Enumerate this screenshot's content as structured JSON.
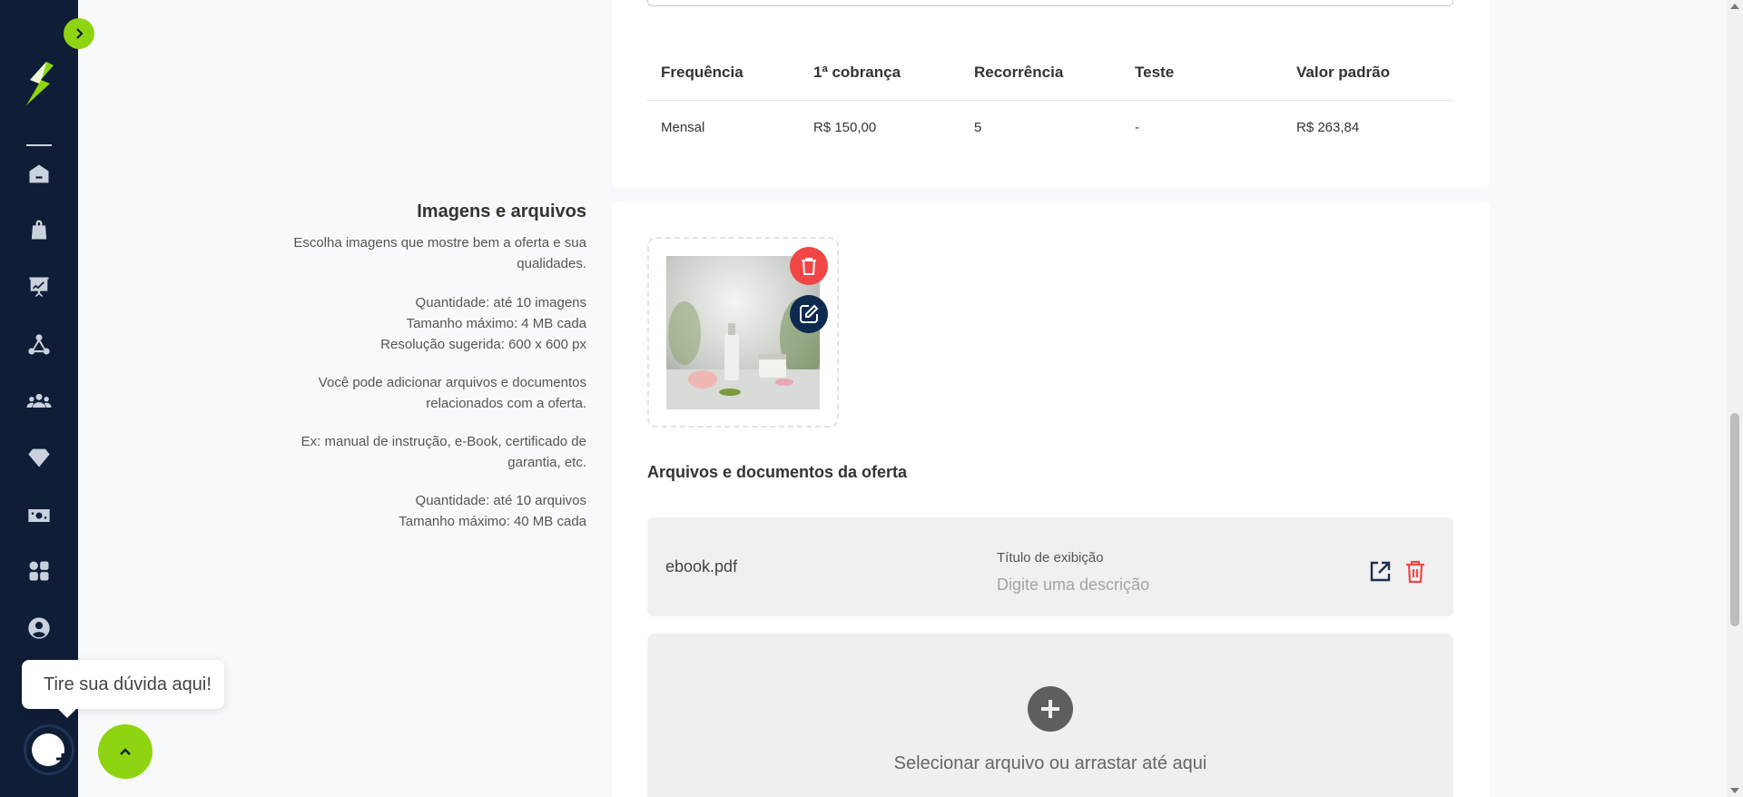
{
  "sidebar": {
    "items": [
      {
        "icon": "home-icon"
      },
      {
        "icon": "shopping-bag-icon"
      },
      {
        "icon": "presentation-chart-icon"
      },
      {
        "icon": "network-icon"
      },
      {
        "icon": "users-group-icon"
      },
      {
        "icon": "diamond-icon"
      },
      {
        "icon": "cash-icon"
      },
      {
        "icon": "apps-grid-icon"
      },
      {
        "icon": "user-circle-icon"
      }
    ]
  },
  "pricing_table": {
    "headers": [
      "Frequência",
      "1ª cobrança",
      "Recorrência",
      "Teste",
      "Valor padrão"
    ],
    "rows": [
      [
        "Mensal",
        "R$ 150,00",
        "5",
        "-",
        "R$ 263,84"
      ]
    ]
  },
  "images_section": {
    "title": "Imagens e arquivos",
    "desc1": "Escolha imagens que mostre bem a oferta e sua qualidades.",
    "desc2_line1": "Quantidade: até 10 imagens",
    "desc2_line2": "Tamanho máximo: 4 MB cada",
    "desc2_line3": "Resolução sugerida: 600 x 600 px",
    "desc3": "Você pode adicionar arquivos e documentos relacionados com a oferta.",
    "desc4": "Ex: manual de instrução, e-Book, certificado de garantia, etc.",
    "desc5_line1": "Quantidade: até 10 arquivos",
    "desc5_line2": "Tamanho máximo: 40 MB cada"
  },
  "files_section": {
    "title": "Arquivos e documentos da oferta",
    "file_name": "ebook.pdf",
    "display_title_label": "Título de exibição",
    "display_title_placeholder": "Digite uma descrição",
    "dropzone_text": "Selecionar arquivo ou arrastar até aqui"
  },
  "help": {
    "tooltip": "Tire sua dúvida aqui!"
  },
  "colors": {
    "sidebar_bg": "#0f1d36",
    "accent_green": "#8fd410",
    "danger_red": "#f04646"
  }
}
